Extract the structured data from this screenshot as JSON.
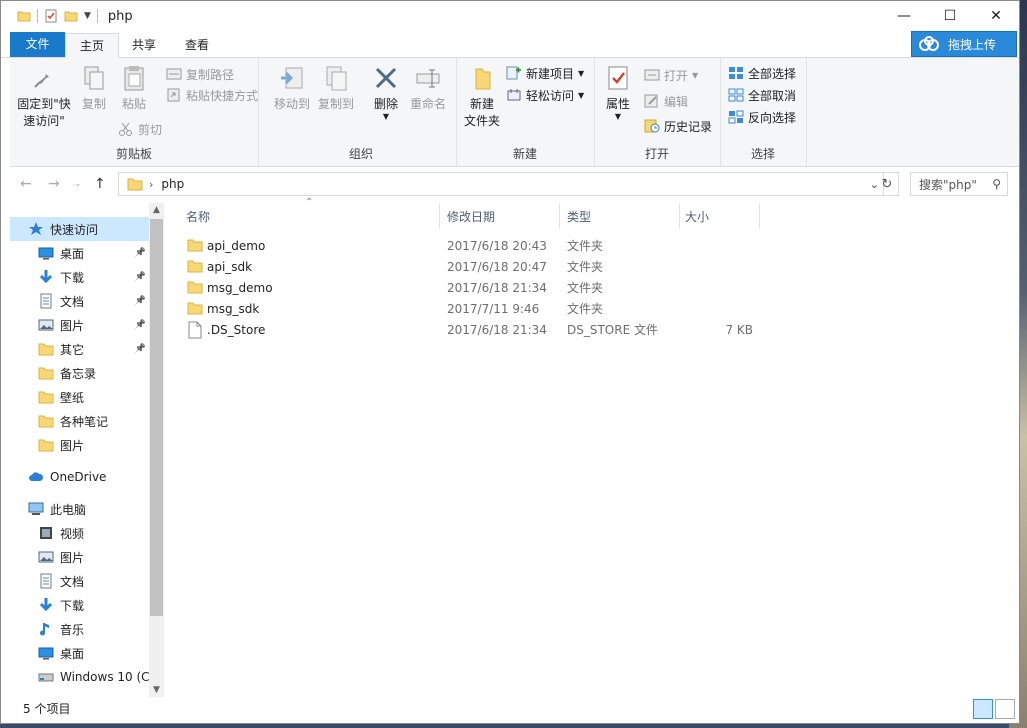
{
  "window": {
    "title": "php"
  },
  "tabs": [
    {
      "label": "文件"
    },
    {
      "label": "主页"
    },
    {
      "label": "共享"
    },
    {
      "label": "查看"
    }
  ],
  "upload_button": "拖拽上传",
  "ribbon": {
    "clipboard": {
      "label": "剪贴板",
      "pin_line1": "固定到\"快",
      "pin_line2": "速访问\"",
      "copy": "复制",
      "paste": "粘贴",
      "copy_path": "复制路径",
      "paste_shortcut": "粘贴快捷方式",
      "cut": "剪切"
    },
    "organize": {
      "label": "组织",
      "move_to": "移动到",
      "copy_to": "复制到",
      "delete": "删除",
      "rename": "重命名"
    },
    "new": {
      "label": "新建",
      "new_folder_line1": "新建",
      "new_folder_line2": "文件夹",
      "new_item": "新建项目",
      "easy_access": "轻松访问"
    },
    "open": {
      "label": "打开",
      "properties": "属性",
      "open": "打开",
      "edit": "编辑",
      "history": "历史记录"
    },
    "select": {
      "label": "选择",
      "select_all": "全部选择",
      "select_none": "全部取消",
      "invert": "反向选择"
    }
  },
  "address": {
    "path": "php",
    "search_placeholder": "搜索\"php\""
  },
  "nav": [
    {
      "label": "快速访问",
      "icon": "star-icon",
      "selected": true
    },
    {
      "label": "桌面",
      "icon": "desktop-icon",
      "pinned": true
    },
    {
      "label": "下载",
      "icon": "download-icon",
      "pinned": true
    },
    {
      "label": "文档",
      "icon": "document-icon",
      "pinned": true
    },
    {
      "label": "图片",
      "icon": "picture-icon",
      "pinned": true
    },
    {
      "label": "其它",
      "icon": "folder-icon",
      "pinned": true
    },
    {
      "label": "备忘录",
      "icon": "folder-icon"
    },
    {
      "label": "壁纸",
      "icon": "folder-icon"
    },
    {
      "label": "各种笔记",
      "icon": "folder-icon"
    },
    {
      "label": "图片",
      "icon": "folder-icon"
    },
    {
      "label": "OneDrive",
      "icon": "cloud-icon"
    },
    {
      "label": "此电脑",
      "icon": "computer-icon"
    },
    {
      "label": "视频",
      "icon": "video-icon"
    },
    {
      "label": "图片",
      "icon": "picture-icon"
    },
    {
      "label": "文档",
      "icon": "document-icon"
    },
    {
      "label": "下载",
      "icon": "download-icon"
    },
    {
      "label": "音乐",
      "icon": "music-icon"
    },
    {
      "label": "桌面",
      "icon": "desktop-icon"
    },
    {
      "label": "Windows 10 (C",
      "icon": "drive-icon"
    }
  ],
  "columns": [
    "名称",
    "修改日期",
    "类型",
    "大小"
  ],
  "files": [
    {
      "name": "api_demo",
      "date": "2017/6/18 20:43",
      "type": "文件夹",
      "size": "",
      "icon": "folder-icon"
    },
    {
      "name": "api_sdk",
      "date": "2017/6/18 20:47",
      "type": "文件夹",
      "size": "",
      "icon": "folder-icon"
    },
    {
      "name": "msg_demo",
      "date": "2017/6/18 21:34",
      "type": "文件夹",
      "size": "",
      "icon": "folder-icon"
    },
    {
      "name": "msg_sdk",
      "date": "2017/7/11 9:46",
      "type": "文件夹",
      "size": "",
      "icon": "folder-icon"
    },
    {
      "name": ".DS_Store",
      "date": "2017/6/18 21:34",
      "type": "DS_STORE 文件",
      "size": "7 KB",
      "icon": "file-icon"
    }
  ],
  "status": "5 个项目",
  "colors": {
    "accent": "#1979ca",
    "folder": "#f8d775",
    "selection": "#cce8ff"
  }
}
